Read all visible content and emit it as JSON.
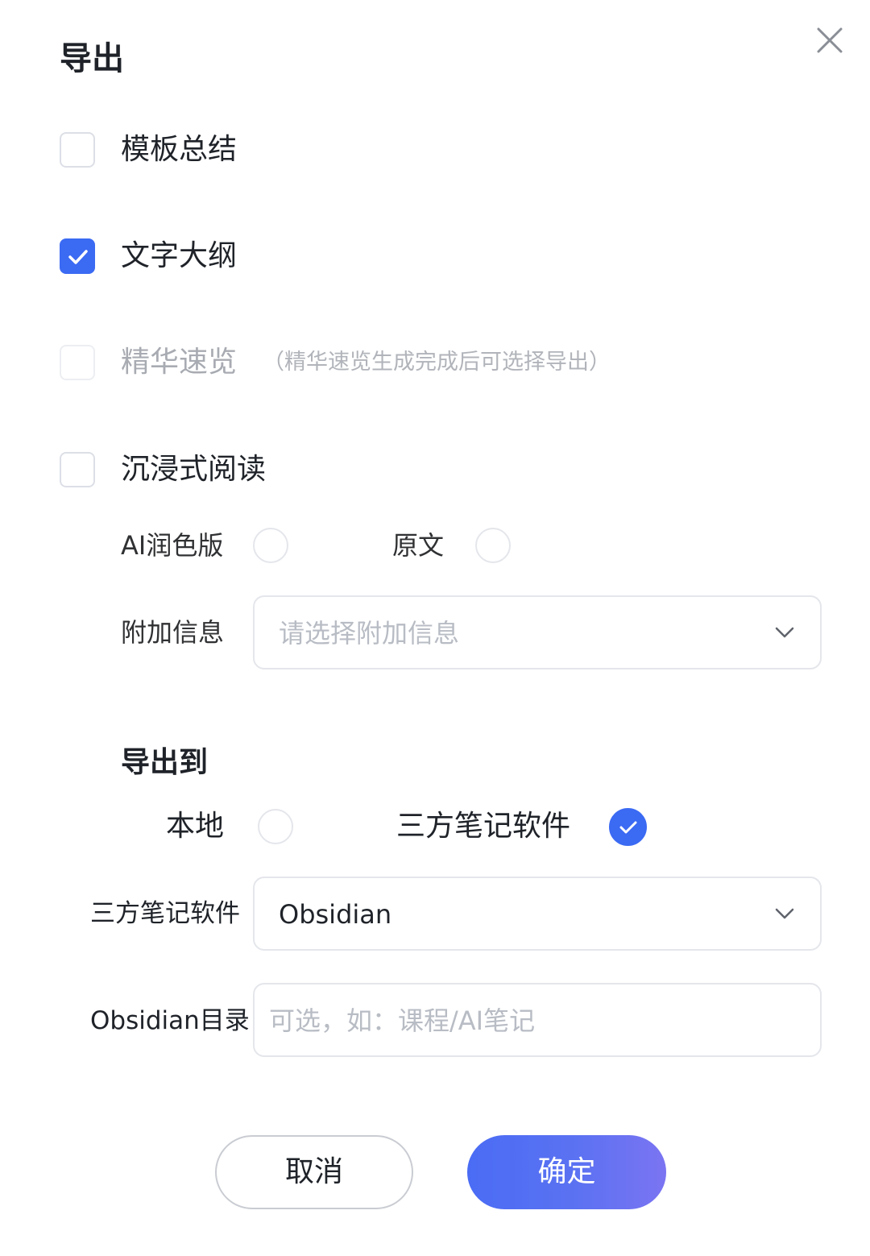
{
  "dialog": {
    "title": "导出"
  },
  "options": [
    {
      "label": "模板总结",
      "checked": false,
      "disabled": false
    },
    {
      "label": "文字大纲",
      "checked": true,
      "disabled": false
    },
    {
      "label": "精华速览",
      "checked": false,
      "disabled": true,
      "note": "（精华速览生成完成后可选择导出）"
    },
    {
      "label": "沉浸式阅读",
      "checked": false,
      "disabled": false
    }
  ],
  "immersive": {
    "version_options": [
      {
        "label": "AI润色版",
        "selected": false
      },
      {
        "label": "原文",
        "selected": false
      }
    ],
    "extra_info": {
      "label": "附加信息",
      "placeholder": "请选择附加信息"
    }
  },
  "export_to": {
    "title": "导出到",
    "destinations": [
      {
        "label": "本地",
        "selected": false
      },
      {
        "label": "三方笔记软件",
        "selected": true
      }
    ],
    "software": {
      "label": "三方笔记软件",
      "value": "Obsidian"
    },
    "directory": {
      "label": "Obsidian目录",
      "placeholder": "可选，如：课程/AI笔记"
    }
  },
  "buttons": {
    "cancel": "取消",
    "confirm": "确定"
  },
  "colors": {
    "accent": "#3b6af3",
    "gradient_start": "#4a6cf4",
    "gradient_end": "#7b74f2"
  }
}
